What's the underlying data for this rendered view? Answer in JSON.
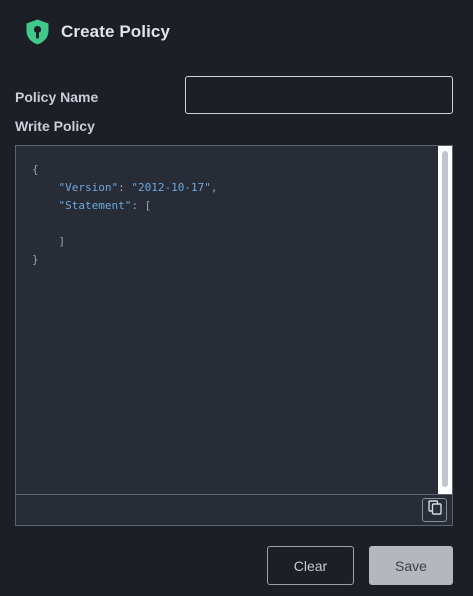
{
  "header": {
    "title": "Create Policy",
    "icon": "shield-keyhole-icon",
    "icon_color": "#3fc98a"
  },
  "form": {
    "policy_name_label": "Policy Name",
    "policy_name_value": "",
    "write_policy_label": "Write Policy"
  },
  "editor": {
    "lines": {
      "l1": "{",
      "l2_key": "\"Version\"",
      "l2_sep": ": ",
      "l2_val": "\"2012-10-17\"",
      "l2_end": ",",
      "l3_key": "\"Statement\"",
      "l3_sep": ": ",
      "l3_open": "[",
      "l5": "]",
      "l6": "}"
    },
    "copy_icon": "copy-icon",
    "colors": {
      "key": "#6ea8de",
      "punctuation": "#9aa2ae",
      "background": "#272c37"
    }
  },
  "actions": {
    "clear_label": "Clear",
    "save_label": "Save"
  }
}
